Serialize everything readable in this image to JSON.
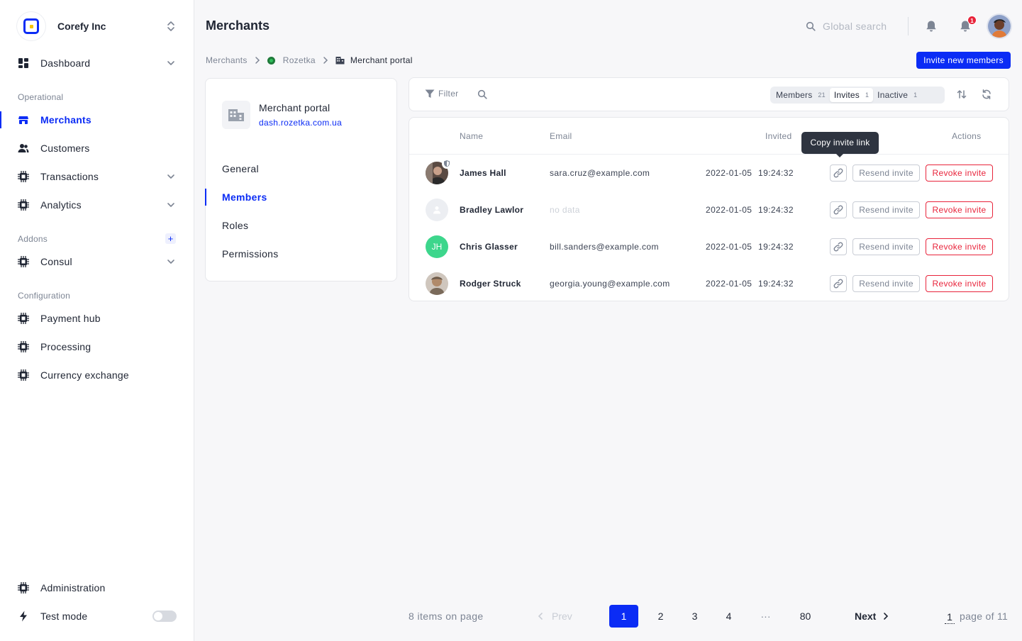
{
  "sidebar": {
    "company": "Corefy Inc",
    "nav": {
      "dashboard": "Dashboard",
      "merchants": "Merchants",
      "customers": "Customers",
      "transactions": "Transactions",
      "analytics": "Analytics",
      "consul": "Consul",
      "payment_hub": "Payment hub",
      "processing": "Processing",
      "currency_exchange": "Currency exchange",
      "administration": "Administration",
      "test_mode": "Test mode"
    },
    "sections": {
      "operational": "Operational",
      "addons": "Addons",
      "configuration": "Configuration"
    },
    "addons_plus": "+",
    "test_mode_enabled": false
  },
  "header": {
    "title": "Merchants",
    "search_placeholder": "Global search",
    "notification_count": "1"
  },
  "breadcrumb": {
    "root": "Merchants",
    "merchant": "Rozetka",
    "current": "Merchant portal"
  },
  "invite_button": "Invite new members",
  "portal": {
    "name": "Merchant portal",
    "domain": "dash.rozetka.com.ua",
    "nav": [
      "General",
      "Members",
      "Roles",
      "Permissions"
    ],
    "active_nav": "Members"
  },
  "toolbar": {
    "filter": "Filter",
    "tabs": [
      {
        "label": "Members",
        "count": "21"
      },
      {
        "label": "Invites",
        "count": "1"
      },
      {
        "label": "Inactive",
        "count": "1"
      }
    ],
    "active_tab": "Invites"
  },
  "table": {
    "columns": {
      "name": "Name",
      "email": "Email",
      "invited": "Invited",
      "actions": "Actions"
    },
    "rows": [
      {
        "name": "James Hall",
        "email": "sara.cruz@example.com",
        "date": "2022-01-05",
        "time": "19:24:32"
      },
      {
        "name": "Bradley Lawlor",
        "email": "no data",
        "date": "2022-01-05",
        "time": "19:24:32"
      },
      {
        "name": "Chris Glasser",
        "initials": "JH",
        "email": "bill.sanders@example.com",
        "date": "2022-01-05",
        "time": "19:24:32"
      },
      {
        "name": "Rodger Struck",
        "email": "georgia.young@example.com",
        "date": "2022-01-05",
        "time": "19:24:32"
      }
    ],
    "resend_label": "Resend invite",
    "revoke_label": "Revoke invite",
    "tooltip": "Copy invite link"
  },
  "pagination": {
    "items_on_page": "8 items on page",
    "prev": "Prev",
    "pages": [
      "1",
      "2",
      "3",
      "4",
      "80"
    ],
    "ellipsis": "···",
    "next": "Next",
    "current_page": "1",
    "page_of": "page of 11"
  },
  "colors": {
    "accent": "#0b2cf5",
    "danger": "#e8243b",
    "initials_avatar": "#3dd68c"
  }
}
